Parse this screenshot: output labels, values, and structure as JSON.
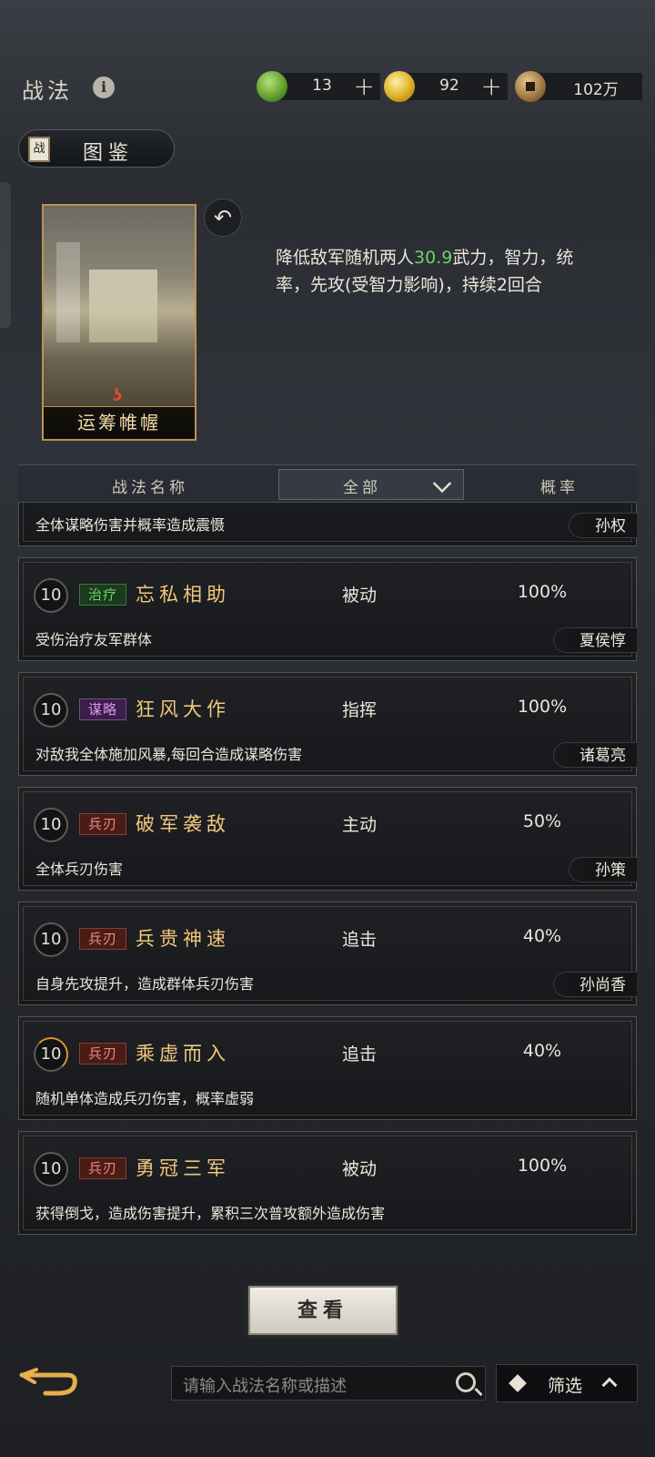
{
  "header": {
    "title": "战法",
    "resources": [
      {
        "icon": "jade-icon",
        "value": "13"
      },
      {
        "icon": "gold-coin-icon",
        "value": "92"
      },
      {
        "icon": "copper-coin-icon",
        "value": "102万"
      }
    ]
  },
  "tujian_label": "图鉴",
  "featured": {
    "card_name": "运筹帷幄",
    "desc_pre": "降低敌军随机两人",
    "desc_value": "30.9",
    "desc_post": "武力，智力，统率，先攻(受智力影响)，持续2回合"
  },
  "table_header": {
    "name_col": "战法名称",
    "filter_value": "全部",
    "rate_col": "概率"
  },
  "partial_row": {
    "desc": "全体谋略伤害并概率造成震慑",
    "hero": "孙权"
  },
  "rows": [
    {
      "level": "10",
      "tag": "治疗",
      "tag_type": "heal",
      "name": "忘私相助",
      "type": "被动",
      "rate": "100%",
      "desc": "受伤治疗友军群体",
      "hero": "夏侯惇"
    },
    {
      "level": "10",
      "tag": "谋略",
      "tag_type": "strat",
      "name": "狂风大作",
      "type": "指挥",
      "rate": "100%",
      "desc": "对敌我全体施加风暴,每回合造成谋略伤害",
      "hero": "诸葛亮"
    },
    {
      "level": "10",
      "tag": "兵刃",
      "tag_type": "blade",
      "name": "破军袭敌",
      "type": "主动",
      "rate": "50%",
      "desc": "全体兵刃伤害",
      "hero": "孙策"
    },
    {
      "level": "10",
      "tag": "兵刃",
      "tag_type": "blade",
      "name": "兵贵神速",
      "type": "追击",
      "rate": "40%",
      "desc": "自身先攻提升，造成群体兵刃伤害",
      "hero": "孙尚香"
    },
    {
      "level": "10",
      "tag": "兵刃",
      "tag_type": "blade",
      "name": "乘虚而入",
      "type": "追击",
      "rate": "40%",
      "desc": "随机单体造成兵刃伤害，概率虚弱",
      "hero": ""
    },
    {
      "level": "10",
      "tag": "兵刃",
      "tag_type": "blade",
      "name": "勇冠三军",
      "type": "被动",
      "rate": "100%",
      "desc": "获得倒戈，造成伤害提升，累积三次普攻额外造成伤害",
      "hero": ""
    }
  ],
  "view_button": "查看",
  "search": {
    "placeholder": "请输入战法名称或描述"
  },
  "filter_button": "筛选"
}
